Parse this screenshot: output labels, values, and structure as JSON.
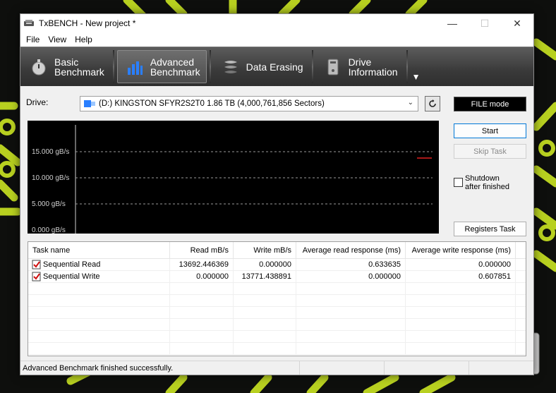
{
  "window": {
    "title": "TxBENCH - New project *"
  },
  "window_controls": {
    "minimize": "—",
    "maximize": "☐",
    "close": "✕"
  },
  "menu": [
    "File",
    "View",
    "Help"
  ],
  "toolbar": {
    "tabs": [
      {
        "line1": "Basic",
        "line2": "Benchmark"
      },
      {
        "line1": "Advanced",
        "line2": "Benchmark"
      },
      {
        "line1": "Data Erasing",
        "line2": ""
      },
      {
        "line1": "Drive",
        "line2": "Information"
      }
    ],
    "overflow": "▼"
  },
  "drive": {
    "label": "Drive:",
    "selected": "(D:) KINGSTON SFYR2S2T0  1.86 TB (4,000,761,856 Sectors)",
    "mode": "FILE mode"
  },
  "graph": {
    "ticks": [
      "15.000 gB/s",
      "10.000 gB/s",
      "5.000 gB/s",
      "0.000 gB/s"
    ],
    "grid_color": "#9a9a9a",
    "line_color": "#e02020"
  },
  "buttons": {
    "start": "Start",
    "skip_task": "Skip Task",
    "registers_task": "Registers Task"
  },
  "shutdown": {
    "line1": "Shutdown",
    "line2": "after finished",
    "checked": false
  },
  "table": {
    "headers": [
      "Task name",
      "Read mB/s",
      "Write mB/s",
      "Average read response (ms)",
      "Average write response (ms)"
    ],
    "rows": [
      {
        "name": "Sequential Read",
        "read": "13692.446369",
        "write": "0.000000",
        "avg_read": "0.633635",
        "avg_write": "0.000000"
      },
      {
        "name": "Sequential Write",
        "read": "0.000000",
        "write": "13771.438891",
        "avg_read": "0.000000",
        "avg_write": "0.607851"
      }
    ]
  },
  "status": {
    "text": "Advanced Benchmark finished successfully."
  },
  "colors": {
    "accent_green": "#b8d020",
    "toolbar_dark": "#3a3a3a"
  }
}
